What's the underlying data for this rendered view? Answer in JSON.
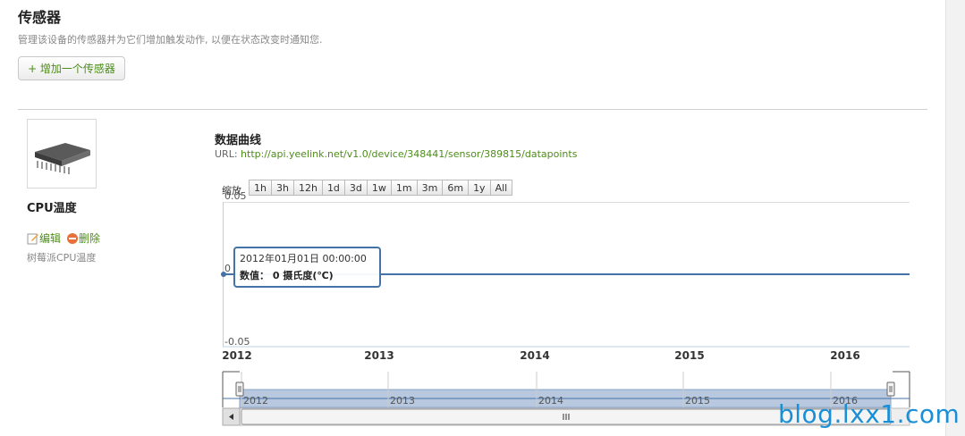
{
  "page": {
    "title": "传感器",
    "subtitle": "管理该设备的传感器并为它们增加触发动作, 以便在状态改变时通知您.",
    "add_button": "+ 增加一个传感器"
  },
  "sensor": {
    "name": "CPU温度",
    "edit_label": "编辑",
    "delete_label": "删除",
    "description": "树莓派CPU温度"
  },
  "chart_section": {
    "title": "数据曲线",
    "url_label": "URL:",
    "url": "http://api.yeelink.net/v1.0/device/348441/sensor/389815/datapoints"
  },
  "zoom": {
    "label": "缩放",
    "buttons": [
      "1h",
      "3h",
      "12h",
      "1d",
      "3d",
      "1w",
      "1m",
      "3m",
      "6m",
      "1y",
      "All"
    ]
  },
  "tooltip": {
    "line1": "2012年01月01日 00:00:00",
    "line2": "数值： 0 摄氏度(℃)"
  },
  "chart_data": {
    "type": "line",
    "title": "",
    "xlabel": "",
    "ylabel": "",
    "x_ticks": [
      "2012",
      "2013",
      "2014",
      "2015",
      "2016"
    ],
    "y_ticks": [
      "0.05",
      "0",
      "-0.05"
    ],
    "ylim": [
      -0.05,
      0.05
    ],
    "series": [
      {
        "values": [
          0,
          0
        ]
      }
    ],
    "x": [
      "2012",
      "2016"
    ],
    "navigator_ticks": [
      "2012",
      "2013",
      "2014",
      "2015",
      "2016"
    ],
    "colors": {
      "line": "#4572a7",
      "navigator_fill": "#b8c8df"
    }
  },
  "watermark": "blog.lxx1.com"
}
